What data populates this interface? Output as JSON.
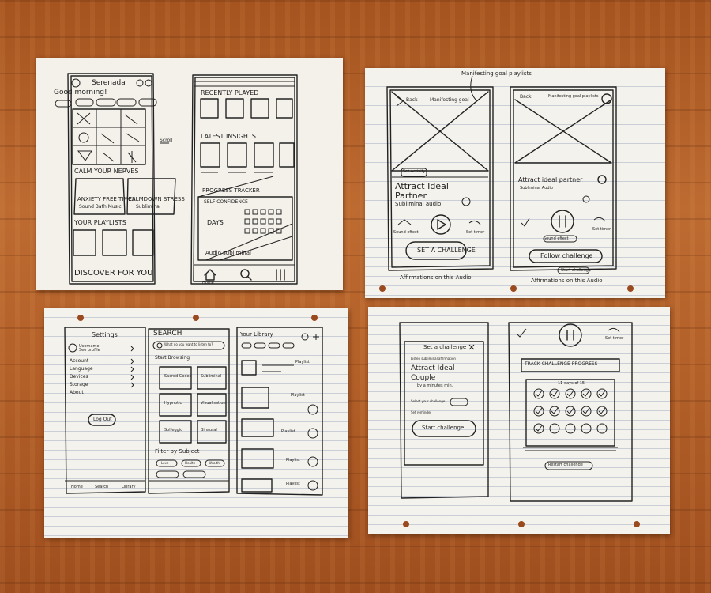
{
  "sheet1": {
    "left": {
      "brand": "Serenada",
      "greeting": "Good morning!",
      "section_calm": "CALM YOUR NERVES",
      "card_a": "ANXIETY FREE TIMES",
      "card_a2": "Sound Bath Music",
      "card_b": "CALMDOWN STRESS",
      "card_b2": "Subliminal",
      "section_playlists": "YOUR PLAYLISTS",
      "section_discover": "DISCOVER FOR YOU",
      "side_note": "Scroll"
    },
    "right": {
      "recently": "RECENTLY PLAYED",
      "insights": "LATEST INSIGHTS",
      "tracker": "PROGRESS TRACKER",
      "tracker_sub": "SELF CONFIDENCE",
      "days": "DAYS",
      "audio": "Audio subliminal",
      "nav_home": "Home"
    }
  },
  "sheet2": {
    "manifest": "Manifesting goal playlists",
    "left": {
      "back": "Back",
      "header": "Manifesting goal",
      "tag": "Set Activity",
      "title1": "Attract Ideal",
      "title2": "Partner",
      "sub": "Subliminal audio",
      "left_lbl": "Sound effect",
      "right_lbl": "Set timer",
      "button": "SET A CHALLENGE",
      "caption": "Affirmations on this Audio"
    },
    "right": {
      "back": "Back",
      "header": "Manifesting goal playlists",
      "title": "Attract ideal partner",
      "sub": "Subliminal Audio",
      "left_lbl": "Sound effect",
      "right_lbl": "Set timer",
      "button": "Follow challenge",
      "small_btn": "Start challenge",
      "caption": "Affirmations on this Audio"
    }
  },
  "sheet3": {
    "settings": {
      "title": "Settings",
      "profile": "Username\nSee profile",
      "items": [
        "Account",
        "Language",
        "Devices",
        "Storage",
        "About"
      ],
      "logout": "Log Out",
      "nav": [
        "Home",
        "Search",
        "Library"
      ]
    },
    "search": {
      "title": "SEARCH",
      "placeholder": "What do you want to listen to?",
      "browse": "Start Browsing",
      "tiles": [
        "Sacred Codes",
        "Subliminal",
        "Hypnotic",
        "Visualisation",
        "Solfeggio",
        "Binaural"
      ],
      "filter": "Filter by Subject",
      "chips": [
        "Love",
        "Health",
        "Wealth"
      ]
    },
    "library": {
      "title": "Your Library",
      "tag": "Playlist"
    }
  },
  "sheet4": {
    "modal": {
      "title": "Set a challenge",
      "body1": "Listen subliminal affirmation",
      "body2": "Attract Ideal",
      "body3": "Couple",
      "body4": "by a minutes min.",
      "select": "Select your challenge",
      "reminder": "Set reminder",
      "button": "Start challenge"
    },
    "track": {
      "timer": "Set timer",
      "title": "TRACK CHALLENGE PROGRESS",
      "count": "11 days of 15",
      "button": "Restart challenge"
    }
  }
}
